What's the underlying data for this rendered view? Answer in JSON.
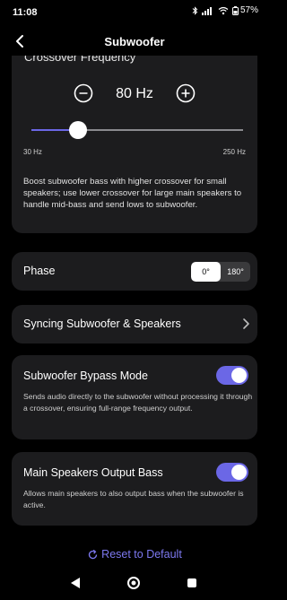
{
  "status_bar": {
    "time": "11:08",
    "battery": "57%"
  },
  "header": {
    "title": "Subwoofer"
  },
  "crossover": {
    "label": "Crossover Frequency",
    "value_text": "80 Hz",
    "slider_fraction": 0.22,
    "range_min": "30 Hz",
    "range_max": "250 Hz",
    "description": "Boost subwoofer bass with higher crossover for small speakers; use lower crossover for large main speakers to handle mid-bass and send lows to subwoofer."
  },
  "phase": {
    "label": "Phase",
    "options": [
      "0°",
      "180°"
    ],
    "selected": "0°"
  },
  "sync": {
    "label": "Syncing Subwoofer & Speakers"
  },
  "bypass": {
    "label": "Subwoofer Bypass Mode",
    "enabled": true,
    "description": "Sends audio directly to the subwoofer without processing it through a crossover, ensuring full-range frequency output."
  },
  "main_bass": {
    "label": "Main Speakers Output Bass",
    "enabled": true,
    "description": "Allows main speakers to also output bass when the subwoofer is active."
  },
  "reset": {
    "label": "Reset to Default"
  },
  "colors": {
    "accent": "#6b67e6",
    "link": "#7d79f0",
    "card": "#1c1c1e",
    "background": "#000000"
  },
  "icons": {
    "back": "chevron-left-icon",
    "minus": "minus-circle-icon",
    "plus": "plus-circle-icon",
    "sync_chevron": "chevron-right-icon",
    "reset": "refresh-icon",
    "nav_back": "triangle-back-icon",
    "nav_home": "circle-home-icon",
    "nav_recents": "square-recents-icon"
  }
}
